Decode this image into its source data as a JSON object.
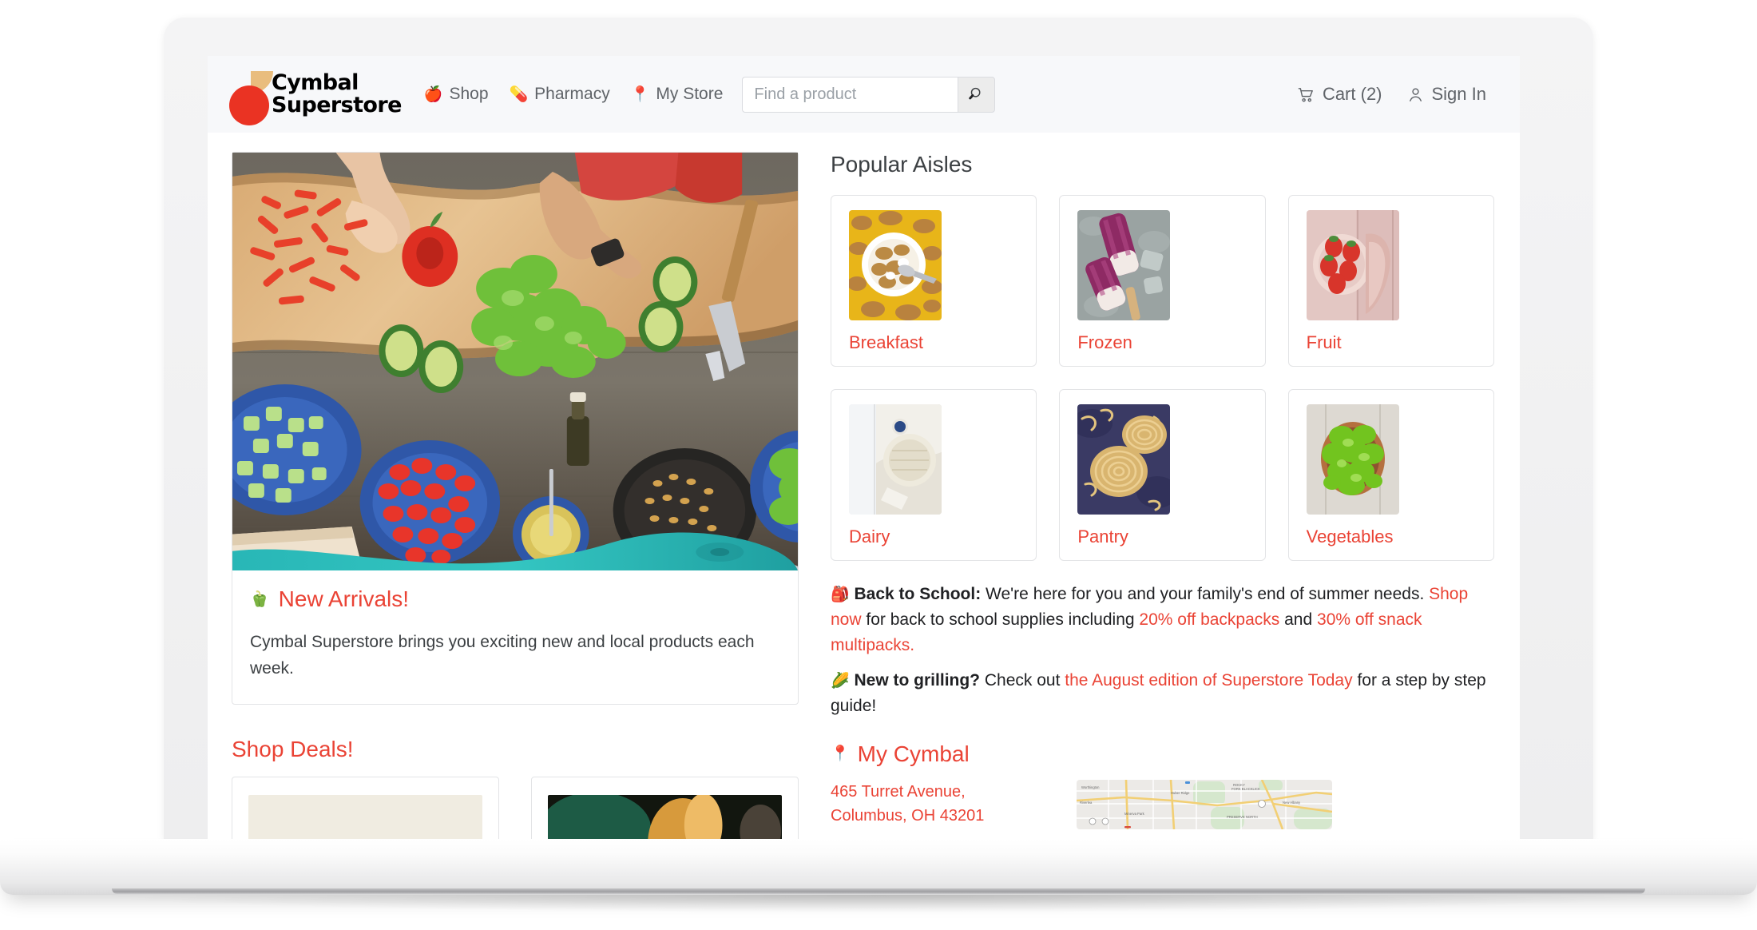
{
  "brand": {
    "line1": "Cymbal",
    "line2": "Superstore",
    "mark_color": "#ea3323",
    "leaf_color": "#e9bd7e"
  },
  "accent_color": "#ea4335",
  "nav": [
    {
      "icon": "apple-icon",
      "glyph": "🍎",
      "label": "Shop"
    },
    {
      "icon": "pill-icon",
      "glyph": "💊",
      "label": "Pharmacy"
    },
    {
      "icon": "pin-icon",
      "glyph": "📍",
      "label": "My Store"
    }
  ],
  "search": {
    "placeholder": "Find a product",
    "value": "",
    "button_icon": "search-icon",
    "button_glyph": "🔍"
  },
  "header_right": {
    "cart_label": "Cart (2)",
    "cart_icon": "cart-icon",
    "signin_label": "Sign In",
    "signin_icon": "person-icon"
  },
  "hero": {
    "image_alt": "people-preparing-vegetables-on-wooden-board",
    "title_glyph": "🫑",
    "title": "New Arrivals!",
    "body": "Cymbal Superstore brings you exciting new and local products each week."
  },
  "deals": {
    "title": "Shop Deals!",
    "cards": [
      {
        "thumb_alt": "deal-product-photo-1"
      },
      {
        "thumb_alt": "deal-product-photo-2"
      }
    ]
  },
  "aisles": {
    "title": "Popular Aisles",
    "items": [
      {
        "label": "Breakfast",
        "thumb_alt": "granola-bowl-photo"
      },
      {
        "label": "Frozen",
        "thumb_alt": "berry-popsicles-photo"
      },
      {
        "label": "Fruit",
        "thumb_alt": "strawberries-bowl-photo"
      },
      {
        "label": "Dairy",
        "thumb_alt": "brie-cheese-photo"
      },
      {
        "label": "Pantry",
        "thumb_alt": "pasta-nests-photo"
      },
      {
        "label": "Vegetables",
        "thumb_alt": "lettuce-bowl-photo"
      }
    ]
  },
  "promo": {
    "back_to_school": {
      "glyph": "🎒",
      "heading": "Back to School:",
      "text1": " We're here for you and your family's end of summer needs. ",
      "link1": "Shop now",
      "text2": " for back to school supplies including ",
      "link2": "20% off backpacks",
      "text3": " and ",
      "link3": "30% off snack multipacks."
    },
    "grilling": {
      "glyph": "🌽",
      "heading": "New to grilling?",
      "text1": " Check out ",
      "link1": "the August edition of Superstore Today",
      "text2": " for a step by step guide!"
    }
  },
  "my_cymbal": {
    "glyph": "📍",
    "title": "My Cymbal",
    "address": "465 Turret Avenue, Columbus, OH 43201",
    "map_alt": "map-of-columbus-oh"
  }
}
